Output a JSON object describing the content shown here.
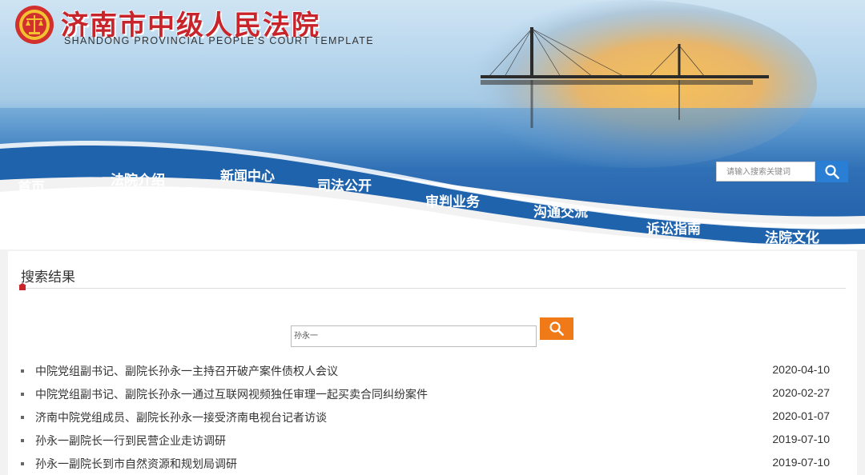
{
  "header": {
    "title_cn": "济南市中级人民法院",
    "title_en": "SHANDONG PROVINCIAL PEOPLE'S COURT TEMPLATE",
    "search_placeholder": "请输入搜索关键词"
  },
  "nav": {
    "items": [
      {
        "label": "首页"
      },
      {
        "label": "法院介绍"
      },
      {
        "label": "新闻中心"
      },
      {
        "label": "司法公开"
      },
      {
        "label": "审判业务"
      },
      {
        "label": "沟通交流"
      },
      {
        "label": "诉讼指南"
      },
      {
        "label": "法院文化"
      }
    ]
  },
  "main": {
    "section_title": "搜索结果",
    "query_value": "孙永一",
    "results": [
      {
        "title": "中院党组副书记、副院长孙永一主持召开破产案件债权人会议",
        "date": "2020-04-10"
      },
      {
        "title": "中院党组副书记、副院长孙永一通过互联网视频独任审理一起买卖合同纠纷案件",
        "date": "2020-02-27"
      },
      {
        "title": "济南中院党组成员、副院长孙永一接受济南电视台记者访谈",
        "date": "2020-01-07"
      },
      {
        "title": "孙永一副院长一行到民营企业走访调研",
        "date": "2019-07-10"
      },
      {
        "title": "孙永一副院长到市自然资源和规划局调研",
        "date": "2019-07-10"
      }
    ]
  },
  "colors": {
    "brand_red": "#c8242b",
    "nav_blue": "#1f63ad",
    "search_blue": "#2a7fd4",
    "query_orange": "#f07a18"
  }
}
